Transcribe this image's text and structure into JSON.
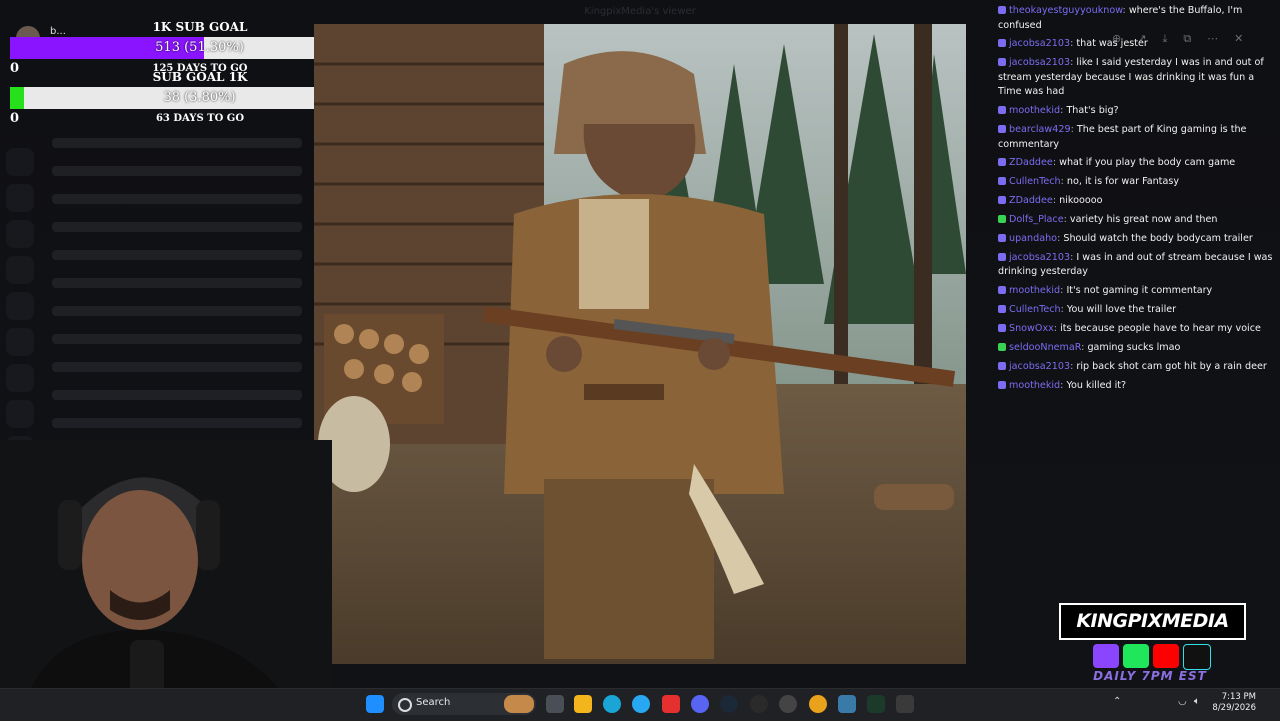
{
  "window_title": "KingpixMedia's viewer",
  "goals": [
    {
      "title": "1K SUB GOAL",
      "current_label": "513 (51.30%)",
      "progress": 0.513,
      "min": "0",
      "max": "1000",
      "days": "125 DAYS TO GO",
      "fill_color": "#8a14ff"
    },
    {
      "title": "SUB GOAL 1K",
      "current_label": "38 (3.80%)",
      "progress": 0.038,
      "min": "0",
      "max": "1000",
      "days": "63 DAYS TO GO",
      "fill_color": "#27e01c"
    }
  ],
  "top_user": "b...",
  "chat": [
    {
      "user": "theokayestguyyouknow",
      "text": "where's the Buffalo, I'm confused",
      "user_color": "#7c6cf2",
      "badge": "#7c6cf2"
    },
    {
      "user": "jacobsa2103",
      "text": "that was jester",
      "user_color": "#7c6cf2",
      "badge": "#7c6cf2"
    },
    {
      "user": "jacobsa2103",
      "text": "like I said yesterday I was in and out of stream yesterday because I was drinking it was fun a Time was had",
      "user_color": "#7c6cf2",
      "badge": "#7c6cf2"
    },
    {
      "user": "moothekid",
      "text": "That's big?",
      "user_color": "#7c6cf2",
      "badge": "#7c6cf2"
    },
    {
      "user": "bearclaw429",
      "text": "The best part of King gaming is the commentary",
      "user_color": "#7c6cf2",
      "badge": "#7c6cf2"
    },
    {
      "user": "ZDaddee",
      "text": "what if you play the body cam game",
      "user_color": "#7c6cf2",
      "badge": "#7c6cf2"
    },
    {
      "user": "CullenTech",
      "text": "no, it is for war Fantasy",
      "user_color": "#7c6cf2",
      "badge": "#7c6cf2"
    },
    {
      "user": "ZDaddee",
      "text": "nikooooo",
      "user_color": "#7c6cf2",
      "badge": "#7c6cf2"
    },
    {
      "user": "Dolfs_Place",
      "text": "variety his great now and then",
      "user_color": "#7c6cf2",
      "badge": "#39d353"
    },
    {
      "user": "upandaho",
      "text": "Should watch the body bodycam trailer",
      "user_color": "#7c6cf2",
      "badge": "#7c6cf2"
    },
    {
      "user": "jacobsa2103",
      "text": "I was in and out of stream because I was drinking yesterday",
      "user_color": "#7c6cf2",
      "badge": "#7c6cf2"
    },
    {
      "user": "moothekid",
      "text": "It's not gaming it commentary",
      "user_color": "#7c6cf2",
      "badge": "#7c6cf2"
    },
    {
      "user": "CullenTech",
      "text": "You will love the trailer",
      "user_color": "#7c6cf2",
      "badge": "#7c6cf2"
    },
    {
      "user": "SnowOxx",
      "text": "its because people have to hear my voice",
      "user_color": "#7c6cf2",
      "badge": "#7c6cf2"
    },
    {
      "user": "seldooNnemaR",
      "text": "gaming sucks lmao",
      "user_color": "#7c6cf2",
      "badge": "#39d353"
    },
    {
      "user": "jacobsa2103",
      "text": "rip back shot cam got hit by a rain deer",
      "user_color": "#7c6cf2",
      "badge": "#7c6cf2"
    },
    {
      "user": "moothekid",
      "text": "You killed it?",
      "user_color": "#7c6cf2",
      "badge": "#7c6cf2"
    }
  ],
  "brand": {
    "name": "KINGPIXMEDIA",
    "schedule": "DAILY 7PM EST",
    "social_icons": [
      "twitch-icon",
      "kick-icon",
      "youtube-icon",
      "tiktok-icon"
    ]
  },
  "taskbar": {
    "search_label": "Search",
    "time": "7:13 PM",
    "date": "8/29/2026"
  }
}
